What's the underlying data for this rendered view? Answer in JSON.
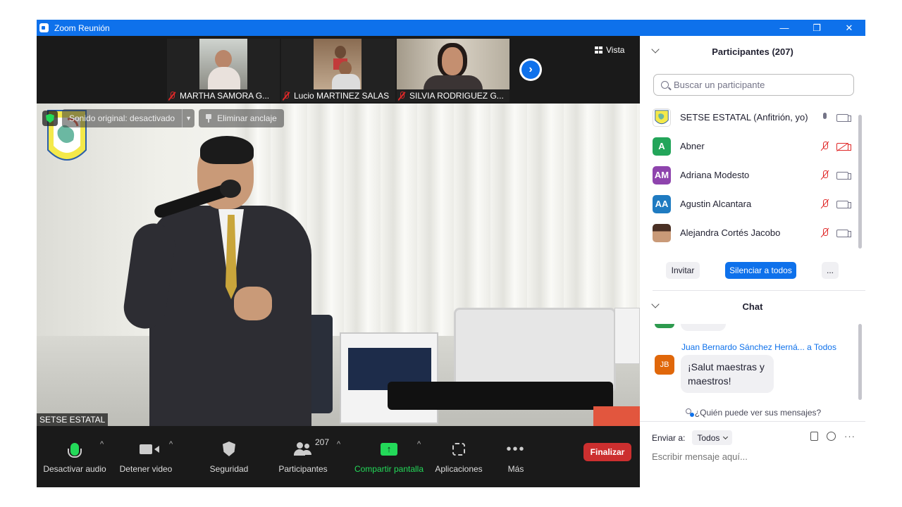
{
  "window": {
    "title": "Zoom Reunión",
    "minimize": "—",
    "restore": "❐",
    "close": "✕"
  },
  "video": {
    "thumbnails": [
      {
        "name": "MARTHA SAMORA G..."
      },
      {
        "name": "Lucio MARTINEZ SALAS"
      },
      {
        "name": "SILVIA RODRIGUEZ G..."
      }
    ],
    "view_label": "Vista",
    "original_sound": "Sonido original: desactivado",
    "unpin_label": "Eliminar anclaje",
    "speaker_name": "SETSE ESTATAL"
  },
  "toolbar": {
    "mute": "Desactivar audio",
    "video": "Detener video",
    "security": "Seguridad",
    "participants": "Participantes",
    "participants_count": "207",
    "share": "Compartir pantalla",
    "apps": "Aplicaciones",
    "more": "Más",
    "end": "Finalizar"
  },
  "participants_panel": {
    "title": "Participantes (207)",
    "search_placeholder": "Buscar un participante",
    "list": [
      {
        "name": "SETSE ESTATAL (Anfitrión, yo)",
        "initials": "",
        "color": "#f2f2a0",
        "mic": "on",
        "cam": "on"
      },
      {
        "name": "Abner",
        "initials": "A",
        "color": "#23a55a",
        "mic": "off",
        "cam": "off"
      },
      {
        "name": "Adriana Modesto",
        "initials": "AM",
        "color": "#8e44ad",
        "mic": "off",
        "cam": "on"
      },
      {
        "name": "Agustin Alcantara",
        "initials": "AA",
        "color": "#1f7bc1",
        "mic": "off",
        "cam": "on"
      },
      {
        "name": "Alejandra Cortés Jacobo",
        "initials": "",
        "color": "#b7856a",
        "mic": "off",
        "cam": "on"
      }
    ],
    "invite": "Invitar",
    "mute_all": "Silenciar a todos",
    "more": "..."
  },
  "chat": {
    "title": "Chat",
    "message": {
      "sender": "Juan Bernardo Sánchez Herná...",
      "to": "a Todos",
      "initials": "JB",
      "text": "¡Salut maestras y maestros!"
    },
    "who_can_see": "¿Quién puede ver sus mensajes?",
    "send_to_label": "Enviar a:",
    "send_to_value": "Todos",
    "input_placeholder": "Escribir mensaje aquí..."
  }
}
